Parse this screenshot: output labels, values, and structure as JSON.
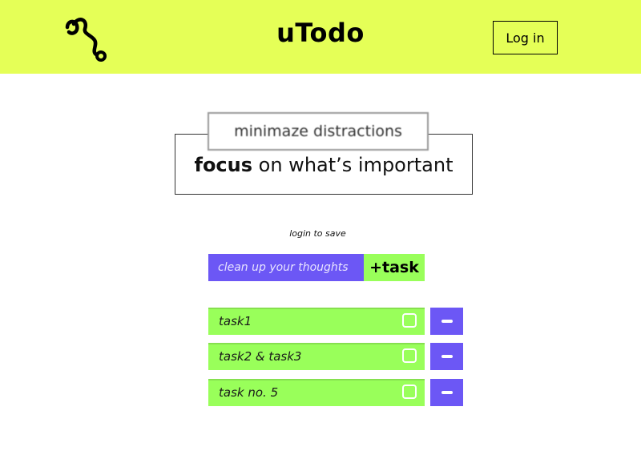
{
  "header": {
    "logo_icon": "squiggle-logo-icon",
    "title": "uTodo",
    "login_label": "Log in"
  },
  "hero": {
    "subtitle": "minimaze distractions",
    "headline_bold": "focus",
    "headline_rest": " on what’s important"
  },
  "save_hint": "login to save",
  "composer": {
    "placeholder": "clean up your thoughts",
    "add_label": "+task"
  },
  "tasks": [
    {
      "label": "task1",
      "checked": false
    },
    {
      "label": "task2 & task3",
      "checked": false
    },
    {
      "label": "task no. 5",
      "checked": false
    }
  ],
  "colors": {
    "header_bg": "#e5ff57",
    "purple": "#6c57f5",
    "green": "#99ff5a"
  }
}
